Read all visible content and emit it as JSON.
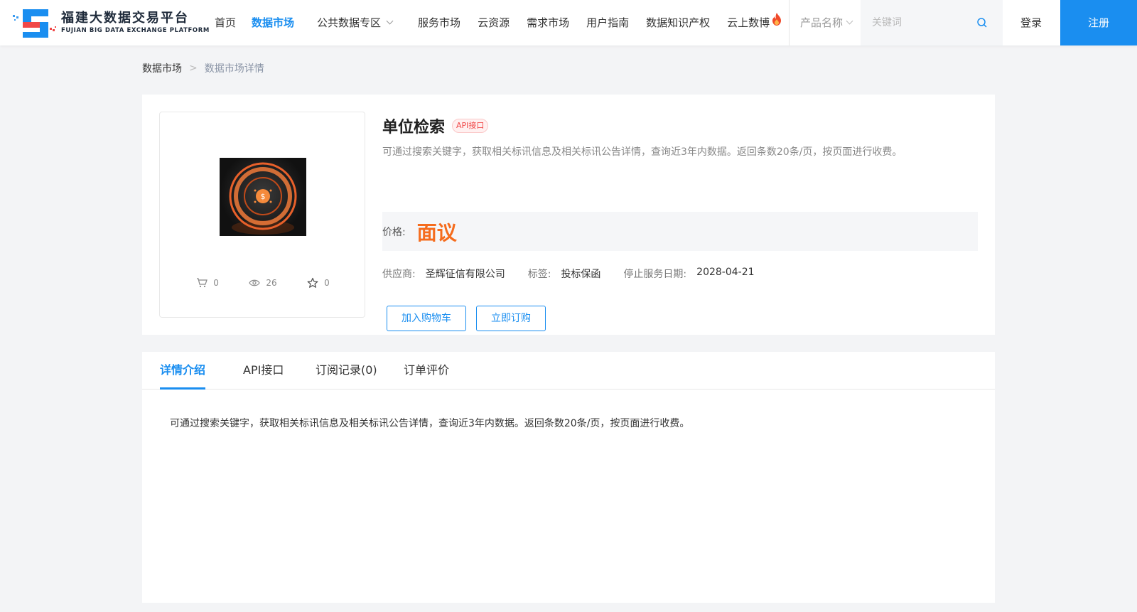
{
  "header": {
    "logo_cn": "福建大数据交易平台",
    "logo_en": "FUJIAN BIG DATA EXCHANGE  PLATFORM",
    "nav": [
      {
        "label": "首页"
      },
      {
        "label": "数据市场",
        "active": true
      },
      {
        "label": "公共数据专区"
      },
      {
        "label": "服务市场"
      },
      {
        "label": "云资源"
      },
      {
        "label": "需求市场"
      },
      {
        "label": "用户指南"
      },
      {
        "label": "数据知识产权"
      },
      {
        "label": "云上数博"
      }
    ],
    "search": {
      "select_value": "产品名称",
      "placeholder": "关键词"
    },
    "login_label": "登录",
    "register_label": "注册",
    "accent_color": "#1a8ef0"
  },
  "breadcrumb": {
    "home": "数据市场",
    "separator": ">",
    "current": "数据市场详情"
  },
  "product": {
    "title": "单位检索",
    "tag": "API接口",
    "description": "可通过搜索关键字，获取相关标讯信息及相关标讯公告详情，查询近3年内数据。返回条数20条/页，按页面进行收费。",
    "price_label": "价格:",
    "price_value": "面议",
    "supplier_label": "供应商:",
    "supplier": "圣辉征信有限公司",
    "tags_label": "标签:",
    "tags": "投标保函",
    "stop_date_label": "停止服务日期:",
    "stop_date": "2028-04-21",
    "stats": {
      "cart": "0",
      "views": "26",
      "favorites": "0"
    },
    "add_to_cart_label": "加入购物车",
    "subscribe_label": "立即订购"
  },
  "detail": {
    "tabs": [
      {
        "label": "详情介绍",
        "active": true
      },
      {
        "label": "API接口"
      },
      {
        "label": "订阅记录(0)"
      },
      {
        "label": "订单评价"
      }
    ],
    "content": "可通过搜索关键字，获取相关标讯信息及相关标讯公告详情，查询近3年内数据。返回条数20条/页，按页面进行收费。"
  }
}
